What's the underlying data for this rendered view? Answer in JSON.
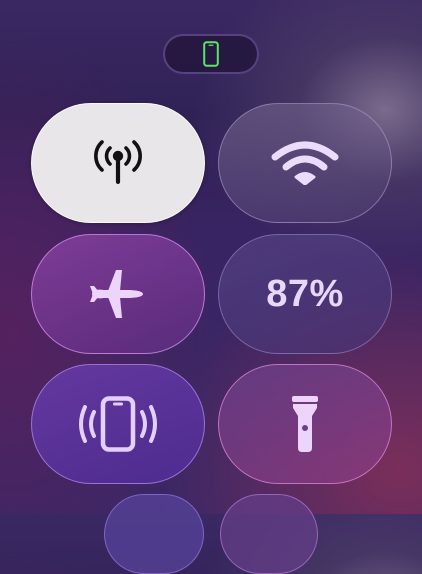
{
  "device_indicator": {
    "icon": "iphone-icon",
    "color": "#5fe36b"
  },
  "tiles": {
    "cellular": {
      "icon": "cellular-antenna-icon",
      "state": "on"
    },
    "wifi": {
      "icon": "wifi-icon",
      "state": "off"
    },
    "airplane_mode": {
      "icon": "airplane-icon",
      "state": "off"
    },
    "battery": {
      "label": "87%"
    },
    "silent_mode": {
      "icon": "vibrate-phone-icon"
    },
    "flashlight": {
      "icon": "flashlight-icon"
    }
  },
  "colors": {
    "tile_icon": "#e7d2fb",
    "active_tile_bg": "#e9e6ea",
    "active_icon": "#111111"
  }
}
